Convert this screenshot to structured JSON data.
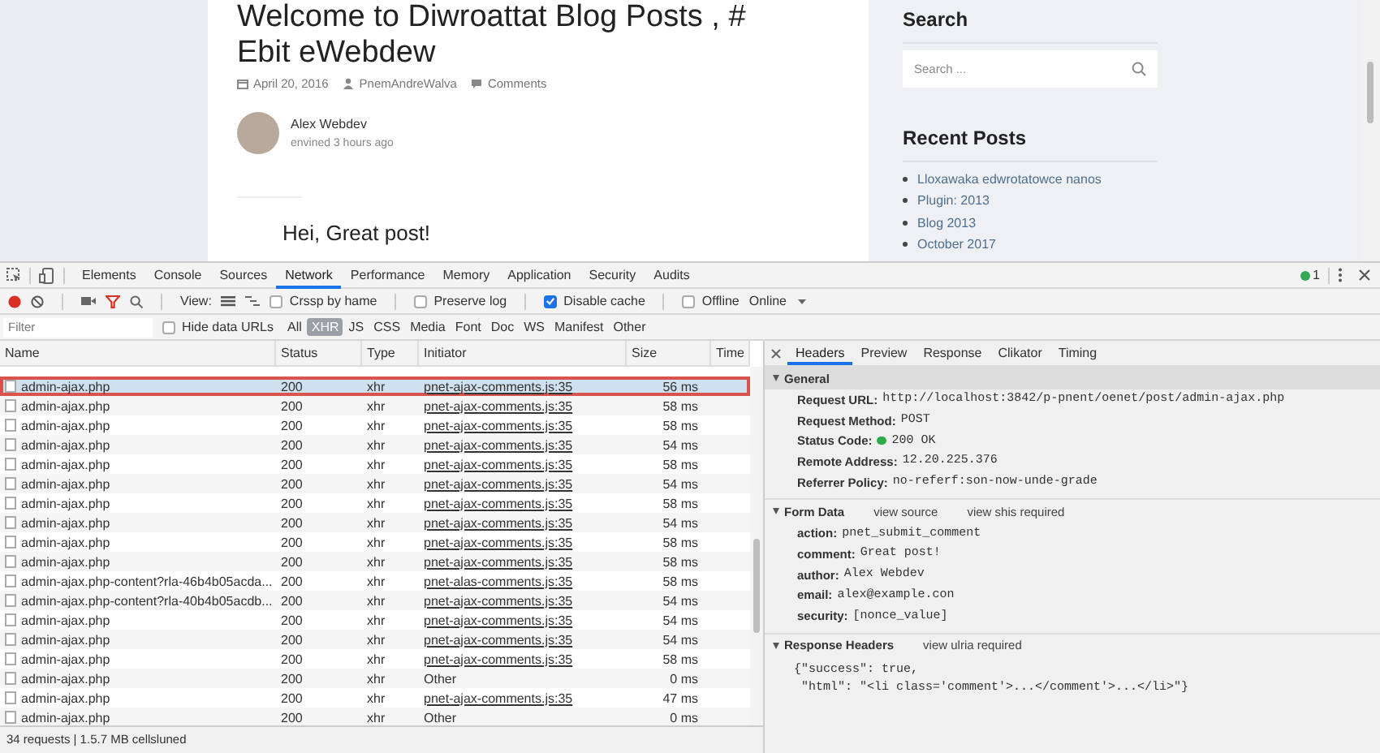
{
  "blog": {
    "title": "Welcome to Diwroattat Blog Posts , # Ebit eWebdew",
    "meta": [
      {
        "kind": "date",
        "text": "April 20, 2016"
      },
      {
        "kind": "author",
        "text": "PnemAndreWalva"
      },
      {
        "kind": "comments",
        "text": "Comments"
      }
    ],
    "comment": {
      "author": "Alex Webdev",
      "time": "envined 3 hours ago",
      "heading": "Hei, Great post!"
    },
    "sidebar": {
      "search_title": "Search",
      "search": {
        "placeholder": "Search ..."
      },
      "recent_title": "Recent Posts",
      "recent_posts": [
        "Lloxawaka edwrotatowce nanos",
        "Plugin: 2013",
        "Blog 2013",
        "October 2017"
      ]
    }
  },
  "devtools": {
    "tabs": [
      {
        "label": "Elements",
        "selected": false
      },
      {
        "label": "Console",
        "selected": false
      },
      {
        "label": "Sources",
        "selected": false
      },
      {
        "label": "Network",
        "selected": true
      },
      {
        "label": "Performance",
        "selected": false
      },
      {
        "label": "Memory",
        "selected": false
      },
      {
        "label": "Application",
        "selected": false
      },
      {
        "label": "Security",
        "selected": false
      },
      {
        "label": "Audits",
        "selected": false
      }
    ],
    "issues_count": "1",
    "toolbar": {
      "recording": true,
      "view_label": "View:",
      "checkboxes": [
        {
          "label": "Crssp by hame",
          "checked": false
        },
        {
          "label": "Preserve log",
          "checked": false
        },
        {
          "label": "Disable cache",
          "checked": true
        },
        {
          "label": "Offline",
          "checked": false
        }
      ],
      "throttle": "Online"
    },
    "filter": {
      "placeholder": "Filter",
      "hide_data_urls": {
        "label": "Hide data URLs",
        "checked": false
      },
      "types": [
        {
          "label": "All",
          "selected": false
        },
        {
          "label": "XHR",
          "selected": true
        },
        {
          "label": "JS",
          "selected": false
        },
        {
          "label": "CSS",
          "selected": false
        },
        {
          "label": "Media",
          "selected": false
        },
        {
          "label": "Font",
          "selected": false
        },
        {
          "label": "Doc",
          "selected": false
        },
        {
          "label": "WS",
          "selected": false
        },
        {
          "label": "Manifest",
          "selected": false
        },
        {
          "label": "Other",
          "selected": false
        }
      ]
    },
    "table": {
      "columns": [
        "Name",
        "Status",
        "Type",
        "Initiator",
        "Size",
        "Time"
      ],
      "rows": [
        {
          "name": "admin-ajax.php",
          "status": "200",
          "type": "xhr",
          "initiator": "pnet-ajax-comments.js:35",
          "link": true,
          "size": "56 ms",
          "selected": true
        },
        {
          "name": "admin-ajax.php",
          "status": "200",
          "type": "xhr",
          "initiator": "pnet-ajax-comments.js:35",
          "link": true,
          "size": "58 ms",
          "selected": false
        },
        {
          "name": "admin-ajax.php",
          "status": "200",
          "type": "xhr",
          "initiator": "pnet-ajax-comments.js:35",
          "link": true,
          "size": "58 ms",
          "selected": false
        },
        {
          "name": "admin-ajax.php",
          "status": "200",
          "type": "xhr",
          "initiator": "pnet-ajax-comments.js:35",
          "link": true,
          "size": "54 ms",
          "selected": false
        },
        {
          "name": "admin-ajax.php",
          "status": "200",
          "type": "xhr",
          "initiator": "pnet-ajax-comments.js:35",
          "link": true,
          "size": "58 ms",
          "selected": false
        },
        {
          "name": "admin-ajax.php",
          "status": "200",
          "type": "xhr",
          "initiator": "pnet-ajax-comments.js:35",
          "link": true,
          "size": "54 ms",
          "selected": false
        },
        {
          "name": "admin-ajax.php",
          "status": "200",
          "type": "xhr",
          "initiator": "pnet-ajax-comments.js:35",
          "link": true,
          "size": "58 ms",
          "selected": false
        },
        {
          "name": "admin-ajax.php",
          "status": "200",
          "type": "xhr",
          "initiator": "pnet-ajax-comments.js:35",
          "link": true,
          "size": "54 ms",
          "selected": false
        },
        {
          "name": "admin-ajax.php",
          "status": "200",
          "type": "xhr",
          "initiator": "pnet-ajax-comments.js:35",
          "link": true,
          "size": "58 ms",
          "selected": false
        },
        {
          "name": "admin-ajax.php",
          "status": "200",
          "type": "xhr",
          "initiator": "pnet-ajax-comments.js:35",
          "link": true,
          "size": "58 ms",
          "selected": false
        },
        {
          "name": "admin-ajax.php-content?rla-46b4b05acda...",
          "status": "200",
          "type": "xhr",
          "initiator": "pnet-alas-comments.js:35",
          "link": true,
          "size": "58 ms",
          "selected": false
        },
        {
          "name": "admin-ajax.php-content?rla-40b4b05acdb...",
          "status": "200",
          "type": "xhr",
          "initiator": "pnet-ajax-comments.js:35",
          "link": true,
          "size": "54 ms",
          "selected": false
        },
        {
          "name": "admin-ajax.php",
          "status": "200",
          "type": "xhr",
          "initiator": "pnet-ajax-comments.js:35",
          "link": true,
          "size": "54 ms",
          "selected": false
        },
        {
          "name": "admin-ajax.php",
          "status": "200",
          "type": "xhr",
          "initiator": "pnet-ajax-comments.js:35",
          "link": true,
          "size": "54 ms",
          "selected": false
        },
        {
          "name": "admin-ajax.php",
          "status": "200",
          "type": "xhr",
          "initiator": "pnet-ajax-comments.js:35",
          "link": true,
          "size": "58 ms",
          "selected": false
        },
        {
          "name": "admin-ajax.php",
          "status": "200",
          "type": "xhr",
          "initiator": "Other",
          "link": false,
          "size": "0 ms",
          "selected": false
        },
        {
          "name": "admin-ajax.php",
          "status": "200",
          "type": "xhr",
          "initiator": "pnet-ajax-comments.js:35",
          "link": true,
          "size": "47 ms",
          "selected": false
        },
        {
          "name": "admin-ajax.php",
          "status": "200",
          "type": "xhr",
          "initiator": "Other",
          "link": false,
          "size": "0 ms",
          "selected": false
        }
      ]
    },
    "status_bar": "34 requests | 1.5.7 MB cellsluned",
    "details": {
      "tabs": [
        {
          "label": "Headers",
          "selected": true
        },
        {
          "label": "Preview",
          "selected": false
        },
        {
          "label": "Response",
          "selected": false
        },
        {
          "label": "Clikator",
          "selected": false
        },
        {
          "label": "Timing",
          "selected": false
        }
      ],
      "sections": [
        {
          "title": "General",
          "expanded": true,
          "shaded": true,
          "fields": [
            {
              "key": "Request URL:",
              "value": "http://localhost:3842/p-pnent/oenet/post/admin-ajax.php",
              "kind": "text"
            },
            {
              "key": "Request Method:",
              "value": "POST",
              "kind": "text"
            },
            {
              "key": "Status Code:",
              "value": "200 OK",
              "kind": "status"
            },
            {
              "key": "Remote Address:",
              "value": "12.20.225.376",
              "kind": "text"
            },
            {
              "key": "Referrer Policy:",
              "value": "no-referf:son-now-unde-grade",
              "kind": "text"
            }
          ]
        },
        {
          "title": "Form Data",
          "expanded": true,
          "shaded": false,
          "links": [
            "view source",
            "view shis required"
          ],
          "fields": [
            {
              "key": "action:",
              "value": "pnet_submit_comment",
              "kind": "text"
            },
            {
              "key": "comment:",
              "value": "Great post!",
              "kind": "text"
            },
            {
              "key": "author:",
              "value": "Alex Webdev",
              "kind": "text"
            },
            {
              "key": "email:",
              "value": "alex@example.con",
              "kind": "text"
            },
            {
              "key": "security:",
              "value": "[nonce_value]",
              "kind": "text"
            }
          ]
        },
        {
          "title": "Response Headers",
          "expanded": true,
          "shaded": false,
          "links": [
            "view ulria required"
          ],
          "code": [
            "{\"success\": true,",
            " \"html\": \"<li class='comment'>...</comment'>...</li>\"}"
          ]
        }
      ]
    }
  }
}
